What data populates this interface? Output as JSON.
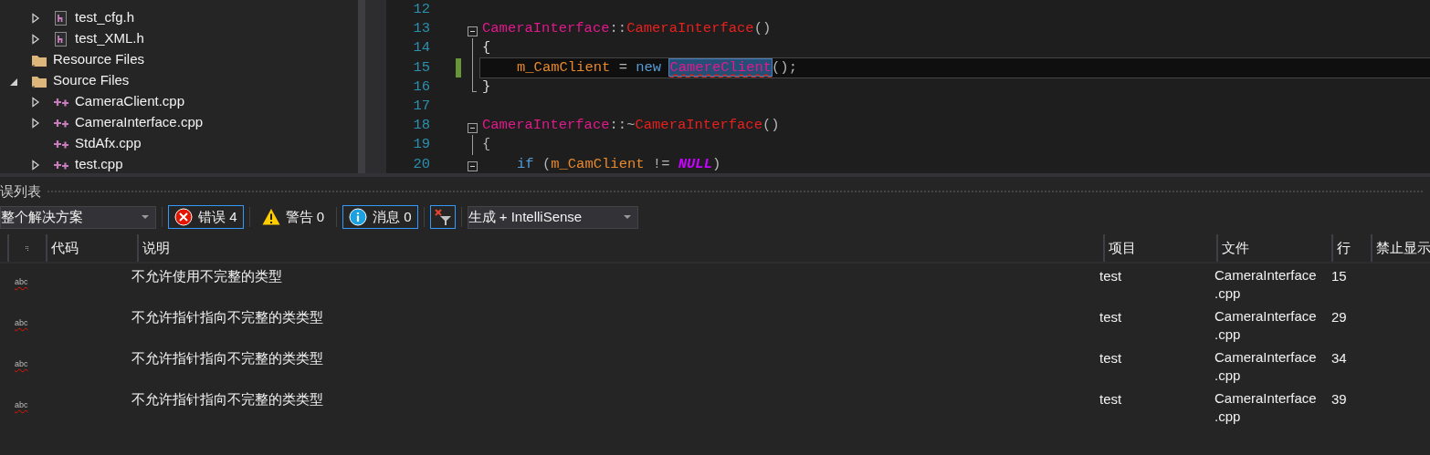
{
  "solution_explorer": {
    "tree": [
      {
        "children": [
          {
            "label": "test_cfg.h",
            "kind": "header",
            "expandable": true,
            "expanded": false
          },
          {
            "label": "test_XML.h",
            "kind": "header",
            "expandable": true,
            "expanded": false
          }
        ]
      },
      {
        "label": "Resource Files",
        "kind": "folder",
        "expandable": false
      },
      {
        "label": "Source Files",
        "kind": "folder",
        "expandable": true,
        "expanded": true,
        "children": [
          {
            "label": "CameraClient.cpp",
            "kind": "cpp",
            "expandable": true,
            "expanded": false
          },
          {
            "label": "CameraInterface.cpp",
            "kind": "cpp",
            "expandable": true,
            "expanded": false
          },
          {
            "label": "StdAfx.cpp",
            "kind": "cpp",
            "expandable": false
          },
          {
            "label": "test.cpp",
            "kind": "cpp",
            "expandable": true,
            "expanded": false
          }
        ]
      }
    ]
  },
  "editor": {
    "lines": [
      {
        "number": "12",
        "kind": "plain",
        "current": false,
        "changed": false
      },
      {
        "number": "13",
        "kind": "fold_start",
        "indented": false,
        "current": false,
        "changed": false,
        "tokens": [
          {
            "text": "CameraInterface",
            "kind": "type"
          },
          {
            "text": "::",
            "kind": "punct"
          },
          {
            "text": "CameraInterface",
            "kind": "func"
          },
          {
            "text": "()",
            "kind": "punct"
          }
        ]
      },
      {
        "number": "14",
        "kind": "fold_body",
        "indented": false,
        "current": false,
        "changed": false,
        "tokens": [
          {
            "text": "{",
            "kind": "plain"
          }
        ]
      },
      {
        "number": "15",
        "kind": "fold_body",
        "indented": true,
        "current": true,
        "changed": true,
        "tokens": [
          {
            "text": "m_CamClient",
            "kind": "var"
          },
          {
            "text": " = ",
            "kind": "punct"
          },
          {
            "text": "new",
            "kind": "keyword"
          },
          {
            "text": "CamereClient",
            "kind": "type",
            "error": true
          },
          {
            "text": "();",
            "kind": "punct"
          }
        ]
      },
      {
        "number": "16",
        "kind": "fold_end",
        "indented": false,
        "current": false,
        "changed": false,
        "tokens": [
          {
            "text": "}",
            "kind": "plain"
          }
        ]
      },
      {
        "number": "17",
        "kind": "plain",
        "current": false,
        "changed": false
      },
      {
        "number": "18",
        "kind": "fold_start",
        "indented": false,
        "current": false,
        "changed": false,
        "tokens": [
          {
            "text": "CameraInterface",
            "kind": "type"
          },
          {
            "text": "::~",
            "kind": "punct"
          },
          {
            "text": "CameraInterface",
            "kind": "func"
          },
          {
            "text": "()",
            "kind": "punct"
          }
        ]
      },
      {
        "number": "19",
        "kind": "fold_body",
        "indented": false,
        "current": false,
        "changed": false,
        "tokens": [
          {
            "text": "{",
            "kind": "punct"
          }
        ]
      },
      {
        "number": "20",
        "kind": "fold_start",
        "indented": true,
        "current": false,
        "changed": false,
        "tokens": [
          {
            "text": "if",
            "kind": "keyword"
          },
          {
            "text": " (",
            "kind": "punct"
          },
          {
            "text": "m_CamClient",
            "kind": "var"
          },
          {
            "text": " != ",
            "kind": "punct"
          },
          {
            "text": "NULL",
            "kind": "macro"
          },
          {
            "text": ")",
            "kind": "punct"
          }
        ]
      }
    ]
  },
  "error_list": {
    "title": "误列表",
    "scope": {
      "value": "整个解决方案"
    },
    "filters": [
      {
        "kind": "error",
        "label": "错误 4",
        "selected": true
      },
      {
        "kind": "warning",
        "label": "警告 0",
        "selected": false
      },
      {
        "kind": "message",
        "label": "消息 0",
        "selected": true
      }
    ],
    "clear_filter": {
      "selected": true
    },
    "source": {
      "value": "生成 + IntelliSense"
    },
    "columns": [
      "代码",
      "说明",
      "项目",
      "文件",
      "行",
      "禁止显示"
    ],
    "rows": [
      {
        "icon_text": "abc",
        "description": "不允许使用不完整的类型",
        "project": "test",
        "file": "CameraInterface.cpp",
        "line": "15"
      },
      {
        "icon_text": "abc",
        "description": "不允许指针指向不完整的类类型",
        "project": "test",
        "file": "CameraInterface.cpp",
        "line": "29"
      },
      {
        "icon_text": "abc",
        "description": "不允许指针指向不完整的类类型",
        "project": "test",
        "file": "CameraInterface.cpp",
        "line": "34"
      },
      {
        "icon_text": "abc",
        "description": "不允许指针指向不完整的类类型",
        "project": "test",
        "file": "CameraInterface.cpp",
        "line": "39"
      }
    ]
  }
}
